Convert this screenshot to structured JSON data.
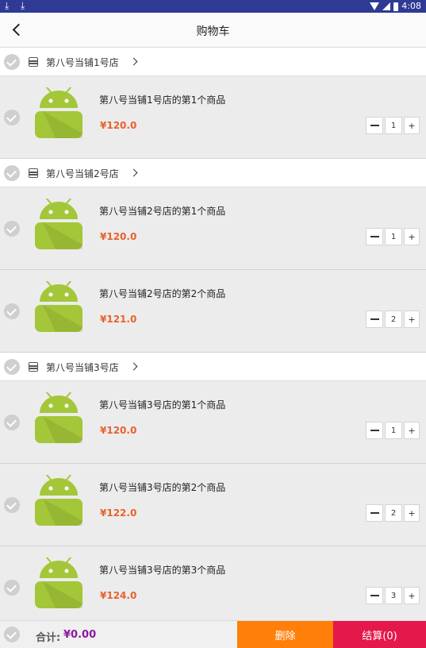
{
  "status_bar": {
    "time": "4:08",
    "download_icon": "download-icon"
  },
  "header": {
    "title": "购物车",
    "back_icon": "back-arrow-icon"
  },
  "stores": [
    {
      "name": "第八号当铺1号店",
      "items": [
        {
          "name": "第八号当铺1号店的第1个商品",
          "price": "¥120.0",
          "quantity": "1"
        }
      ]
    },
    {
      "name": "第八号当铺2号店",
      "items": [
        {
          "name": "第八号当铺2号店的第1个商品",
          "price": "¥120.0",
          "quantity": "1"
        },
        {
          "name": "第八号当铺2号店的第2个商品",
          "price": "¥121.0",
          "quantity": "2"
        }
      ]
    },
    {
      "name": "第八号当铺3号店",
      "items": [
        {
          "name": "第八号当铺3号店的第1个商品",
          "price": "¥120.0",
          "quantity": "1"
        },
        {
          "name": "第八号当铺3号店的第2个商品",
          "price": "¥122.0",
          "quantity": "2"
        },
        {
          "name": "第八号当铺3号店的第3个商品",
          "price": "¥124.0",
          "quantity": "3"
        }
      ]
    }
  ],
  "stepper": {
    "plus": "+"
  },
  "footer": {
    "total_label": "合计:",
    "total_value": "¥0.00",
    "delete_label": "删除",
    "checkout_label": "结算(0)"
  },
  "colors": {
    "status_bar": "#2e3a94",
    "price": "#e8612c",
    "total": "#8a1aa0",
    "delete": "#ff7f0a",
    "checkout": "#e4184a",
    "android_green": "#a4c639"
  }
}
